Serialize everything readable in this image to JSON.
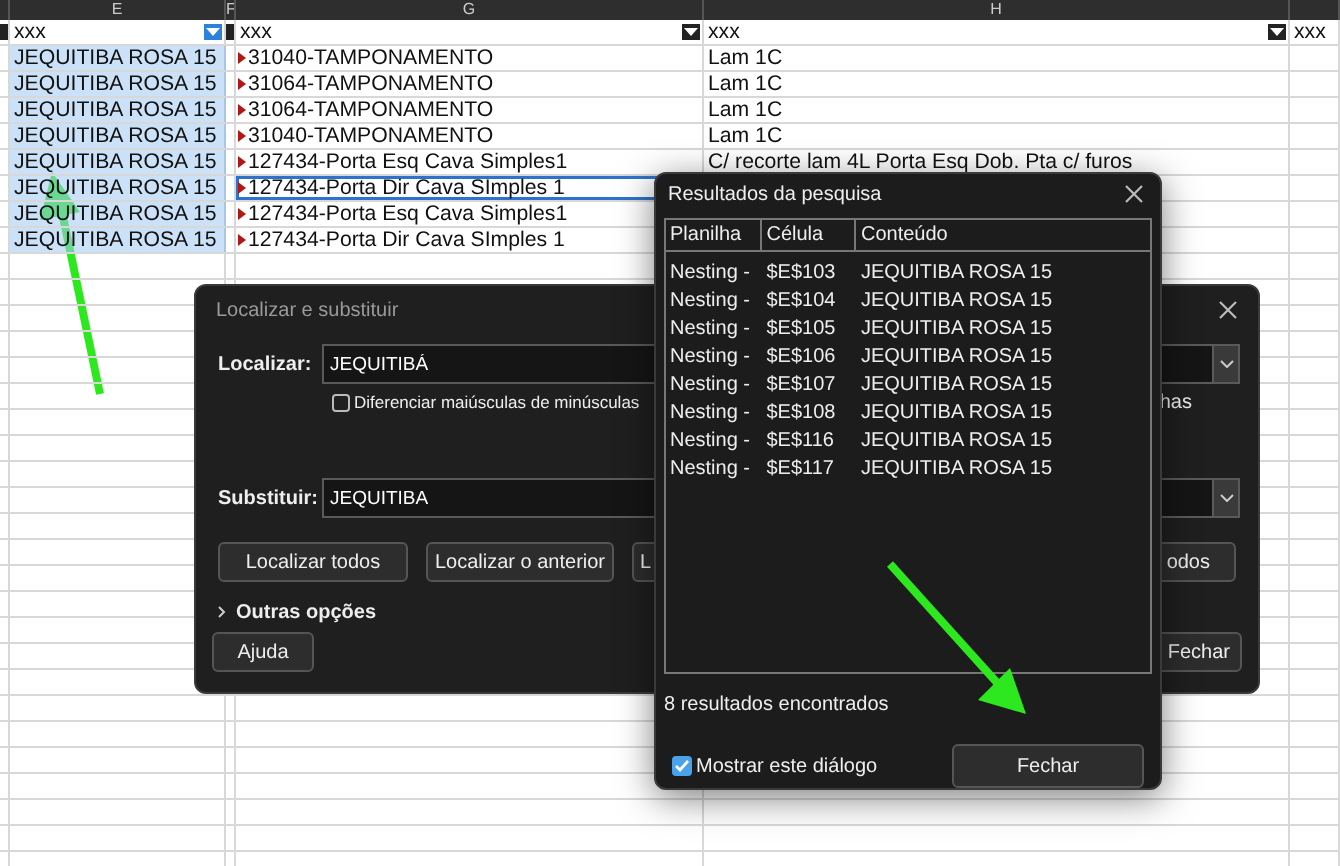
{
  "spreadsheet": {
    "columns": [
      {
        "filter_active": false
      },
      {
        "header": "E",
        "filter_text": "xxx",
        "filter_active": true
      },
      {
        "header": "F",
        "filter_active": false
      },
      {
        "header": "G",
        "filter_text": "xxx",
        "filter_active": false
      },
      {
        "header": "H",
        "filter_text": "xxx",
        "filter_active": false
      },
      {
        "filter_text": "xxx"
      }
    ],
    "rows": [
      {
        "e": "JEQUITIBA ROSA 15",
        "g": "31040-TAMPONAMENTO",
        "h": "Lam 1C",
        "selected": true,
        "current": false
      },
      {
        "e": "JEQUITIBA ROSA 15",
        "g": "31064-TAMPONAMENTO",
        "h": "Lam 1C",
        "selected": true,
        "current": false
      },
      {
        "e": "JEQUITIBA ROSA 15",
        "g": "31064-TAMPONAMENTO",
        "h": "Lam 1C",
        "selected": true,
        "current": false
      },
      {
        "e": "JEQUITIBA ROSA 15",
        "g": "31040-TAMPONAMENTO",
        "h": "Lam 1C",
        "selected": true,
        "current": false
      },
      {
        "e": "JEQUITIBA ROSA 15",
        "g": "127434-Porta Esq Cava Simples1",
        "h": "C/ recorte lam 4L Porta Esq Dob. Pta c/ furos",
        "selected": true,
        "current": false
      },
      {
        "e": "JEQUITIBA ROSA 15",
        "g": "127434-Porta Dir Cava SImples 1",
        "selected": true,
        "current": true
      },
      {
        "e": "JEQUITIBA ROSA 15",
        "g": "127434-Porta Esq Cava Simples1",
        "selected": true,
        "current": false
      },
      {
        "e": "JEQUITIBA ROSA 15",
        "g": "127434-Porta Dir Cava SImples 1",
        "selected": true,
        "current": false
      }
    ]
  },
  "find_replace": {
    "title": "Localizar e substituir",
    "find_label": "Localizar:",
    "find_value": "JEQUITIBÁ",
    "match_case": {
      "label": "Diferenciar maiúsculas de minúsculas",
      "checked": false
    },
    "partial_option": "has",
    "replace_label": "Substituir:",
    "replace_value": "JEQUITIBA",
    "buttons": [
      "Localizar todos",
      "Localizar o anterior",
      "L"
    ],
    "right_button": "odos",
    "more_options": "Outras opções",
    "help": "Ajuda",
    "close": "Fechar"
  },
  "results": {
    "title": "Resultados da pesquisa",
    "columns": [
      "Planilha",
      "Célula",
      "Conteúdo"
    ],
    "rows": [
      {
        "sheet": "Nesting -",
        "cell": "$E$103",
        "content": "JEQUITIBA ROSA 15"
      },
      {
        "sheet": "Nesting -",
        "cell": "$E$104",
        "content": "JEQUITIBA ROSA 15"
      },
      {
        "sheet": "Nesting -",
        "cell": "$E$105",
        "content": "JEQUITIBA ROSA 15"
      },
      {
        "sheet": "Nesting -",
        "cell": "$E$106",
        "content": "JEQUITIBA ROSA 15"
      },
      {
        "sheet": "Nesting -",
        "cell": "$E$107",
        "content": "JEQUITIBA ROSA 15"
      },
      {
        "sheet": "Nesting -",
        "cell": "$E$108",
        "content": "JEQUITIBA ROSA 15"
      },
      {
        "sheet": "Nesting -",
        "cell": "$E$116",
        "content": "JEQUITIBA ROSA 15"
      },
      {
        "sheet": "Nesting -",
        "cell": "$E$117",
        "content": "JEQUITIBA ROSA 15"
      }
    ],
    "summary": "8 resultados encontrados",
    "show_dialog": {
      "label": "Mostrar este diálogo",
      "checked": true
    },
    "close": "Fechar"
  }
}
